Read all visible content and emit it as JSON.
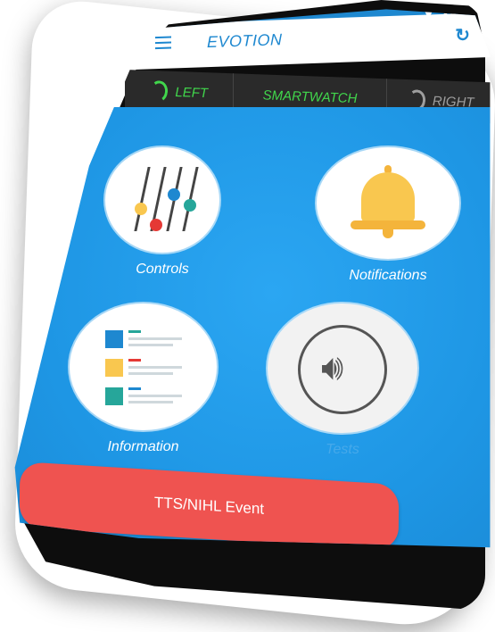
{
  "app": {
    "title": "EVOTION"
  },
  "status_bar": {
    "icons": "▼◢▮"
  },
  "tabs": [
    {
      "label": "LEFT",
      "state": "connected"
    },
    {
      "label": "SMARTWATCH",
      "state": "connected"
    },
    {
      "label": "RIGHT",
      "state": "disconnected"
    }
  ],
  "tiles": {
    "controls": {
      "label": "Controls",
      "icon": "sliders-icon"
    },
    "notifications": {
      "label": "Notifications",
      "icon": "bell-icon"
    },
    "information": {
      "label": "Information",
      "icon": "list-icon"
    },
    "tests": {
      "label": "Tests",
      "icon": "speaker-icon"
    }
  },
  "event_button": {
    "label": "TTS/NIHL Event"
  },
  "nav": {
    "back": "◁",
    "home": "○",
    "recent": "□"
  },
  "colors": {
    "primary": "#1e88d0",
    "connected": "#41d64c",
    "disconnected": "#9e9e9e",
    "event": "#ef5350"
  }
}
